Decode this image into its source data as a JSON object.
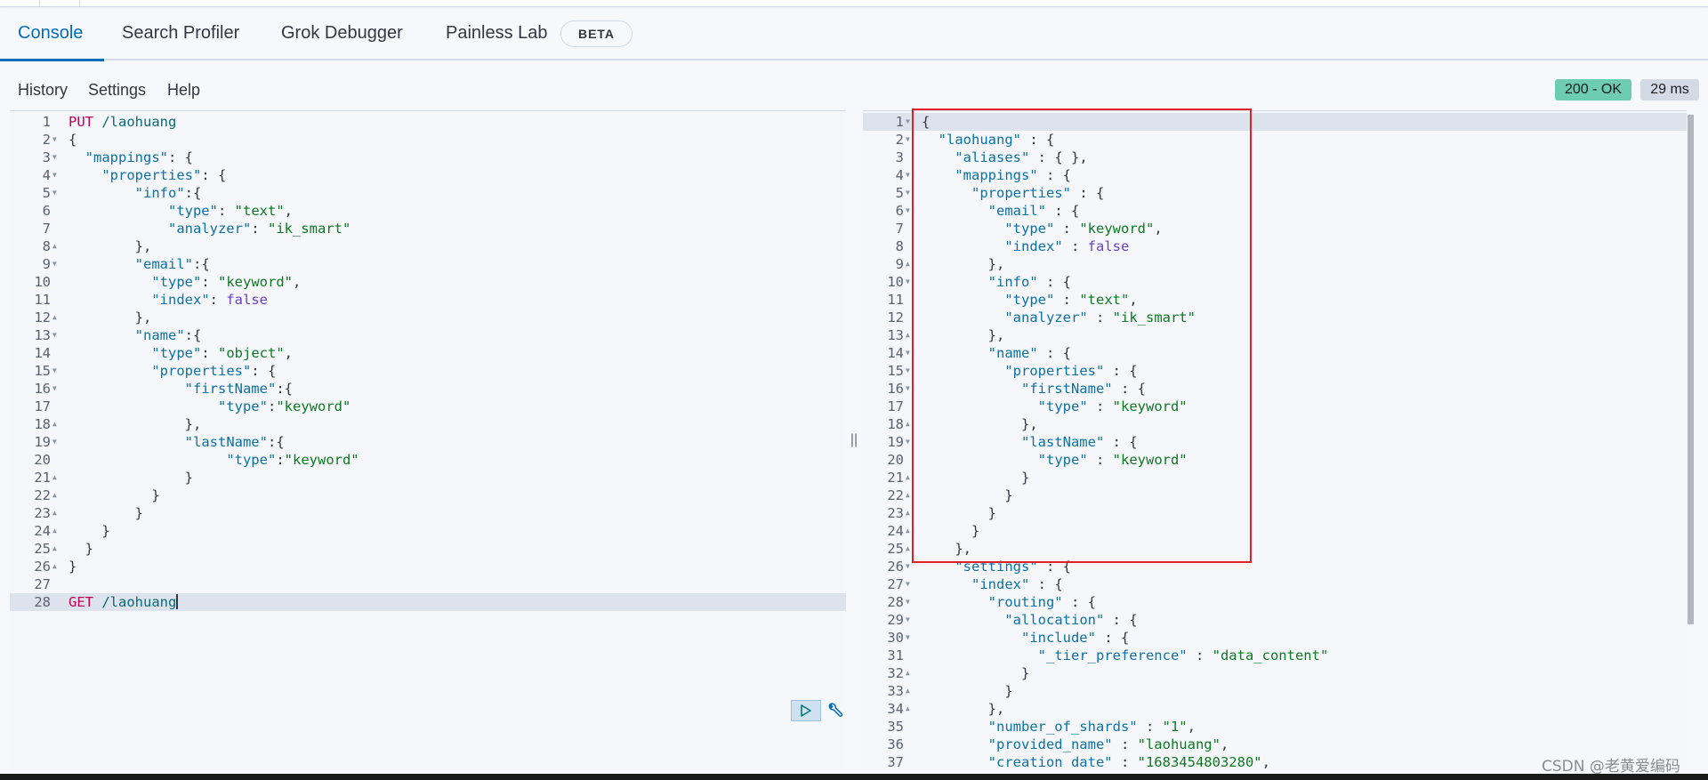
{
  "tabs": [
    {
      "label": "Console",
      "active": true
    },
    {
      "label": "Search Profiler",
      "active": false
    },
    {
      "label": "Grok Debugger",
      "active": false
    },
    {
      "label": "Painless Lab",
      "active": false
    }
  ],
  "beta_badge": "BETA",
  "menu": {
    "history": "History",
    "settings": "Settings",
    "help": "Help"
  },
  "status": {
    "code": "200 - OK",
    "time": "29 ms",
    "ok_color": "#6dccb1"
  },
  "request_editor": {
    "active_line": 28,
    "actions": {
      "run": "play-icon",
      "wrench": "wrench-icon"
    },
    "lines": [
      {
        "n": "1",
        "fold": "",
        "html": "<span class=\"m\">PUT</span> <span class=\"u\">/laohuang</span>"
      },
      {
        "n": "2",
        "fold": "▼",
        "html": "{"
      },
      {
        "n": "3",
        "fold": "▼",
        "html": "  <span class=\"k\">\"mappings\"</span>: {"
      },
      {
        "n": "4",
        "fold": "▼",
        "html": "    <span class=\"k\">\"properties\"</span>: {"
      },
      {
        "n": "5",
        "fold": "▼",
        "html": "        <span class=\"k\">\"info\"</span>:{"
      },
      {
        "n": "6",
        "fold": "",
        "html": "            <span class=\"k\">\"type\"</span>: <span class=\"s\">\"text\"</span>,"
      },
      {
        "n": "7",
        "fold": "",
        "html": "            <span class=\"k\">\"analyzer\"</span>: <span class=\"s\">\"ik_smart\"</span>"
      },
      {
        "n": "8",
        "fold": "▲",
        "html": "        },"
      },
      {
        "n": "9",
        "fold": "▼",
        "html": "        <span class=\"k\">\"email\"</span>:{"
      },
      {
        "n": "10",
        "fold": "",
        "html": "          <span class=\"k\">\"type\"</span>: <span class=\"s\">\"keyword\"</span>,"
      },
      {
        "n": "11",
        "fold": "",
        "html": "          <span class=\"k\">\"index\"</span>: <span class=\"b\">false</span>"
      },
      {
        "n": "12",
        "fold": "▲",
        "html": "        },"
      },
      {
        "n": "13",
        "fold": "▼",
        "html": "        <span class=\"k\">\"name\"</span>:{"
      },
      {
        "n": "14",
        "fold": "",
        "html": "          <span class=\"k\">\"type\"</span>: <span class=\"s\">\"object\"</span>,"
      },
      {
        "n": "15",
        "fold": "▼",
        "html": "          <span class=\"k\">\"properties\"</span>: {"
      },
      {
        "n": "16",
        "fold": "▼",
        "html": "              <span class=\"k\">\"firstName\"</span>:{"
      },
      {
        "n": "17",
        "fold": "",
        "html": "                  <span class=\"k\">\"type\"</span>:<span class=\"s\">\"keyword\"</span>"
      },
      {
        "n": "18",
        "fold": "▲",
        "html": "              },"
      },
      {
        "n": "19",
        "fold": "▼",
        "html": "              <span class=\"k\">\"lastName\"</span>:{"
      },
      {
        "n": "20",
        "fold": "",
        "html": "                   <span class=\"k\">\"type\"</span>:<span class=\"s\">\"keyword\"</span>"
      },
      {
        "n": "21",
        "fold": "▲",
        "html": "              }"
      },
      {
        "n": "22",
        "fold": "▲",
        "html": "          }"
      },
      {
        "n": "23",
        "fold": "▲",
        "html": "        }"
      },
      {
        "n": "24",
        "fold": "▲",
        "html": "    }"
      },
      {
        "n": "25",
        "fold": "▲",
        "html": "  }"
      },
      {
        "n": "26",
        "fold": "▲",
        "html": "}"
      },
      {
        "n": "27",
        "fold": "",
        "html": ""
      },
      {
        "n": "28",
        "fold": "",
        "html": "<span class=\"m\">GET</span> <span class=\"u\">/laohuang</span><span class=\"cursor\"></span>"
      }
    ]
  },
  "response_editor": {
    "active_line": 1,
    "lines": [
      {
        "n": "1",
        "fold": "▼",
        "html": "{"
      },
      {
        "n": "2",
        "fold": "▼",
        "html": "  <span class=\"k\">\"laohuang\"</span> : {"
      },
      {
        "n": "3",
        "fold": "",
        "html": "    <span class=\"k\">\"aliases\"</span> : { },"
      },
      {
        "n": "4",
        "fold": "▼",
        "html": "    <span class=\"k\">\"mappings\"</span> : {"
      },
      {
        "n": "5",
        "fold": "▼",
        "html": "      <span class=\"k\">\"properties\"</span> : {"
      },
      {
        "n": "6",
        "fold": "▼",
        "html": "        <span class=\"k\">\"email\"</span> : {"
      },
      {
        "n": "7",
        "fold": "",
        "html": "          <span class=\"k\">\"type\"</span> : <span class=\"s\">\"keyword\"</span>,"
      },
      {
        "n": "8",
        "fold": "",
        "html": "          <span class=\"k\">\"index\"</span> : <span class=\"b\">false</span>"
      },
      {
        "n": "9",
        "fold": "▲",
        "html": "        },"
      },
      {
        "n": "10",
        "fold": "▼",
        "html": "        <span class=\"k\">\"info\"</span> : {"
      },
      {
        "n": "11",
        "fold": "",
        "html": "          <span class=\"k\">\"type\"</span> : <span class=\"s\">\"text\"</span>,"
      },
      {
        "n": "12",
        "fold": "",
        "html": "          <span class=\"k\">\"analyzer\"</span> : <span class=\"s\">\"ik_smart\"</span>"
      },
      {
        "n": "13",
        "fold": "▲",
        "html": "        },"
      },
      {
        "n": "14",
        "fold": "▼",
        "html": "        <span class=\"k\">\"name\"</span> : {"
      },
      {
        "n": "15",
        "fold": "▼",
        "html": "          <span class=\"k\">\"properties\"</span> : {"
      },
      {
        "n": "16",
        "fold": "▼",
        "html": "            <span class=\"k\">\"firstName\"</span> : {"
      },
      {
        "n": "17",
        "fold": "",
        "html": "              <span class=\"k\">\"type\"</span> : <span class=\"s\">\"keyword\"</span>"
      },
      {
        "n": "18",
        "fold": "▲",
        "html": "            },"
      },
      {
        "n": "19",
        "fold": "▼",
        "html": "            <span class=\"k\">\"lastName\"</span> : {"
      },
      {
        "n": "20",
        "fold": "",
        "html": "              <span class=\"k\">\"type\"</span> : <span class=\"s\">\"keyword\"</span>"
      },
      {
        "n": "21",
        "fold": "▲",
        "html": "            }"
      },
      {
        "n": "22",
        "fold": "▲",
        "html": "          }"
      },
      {
        "n": "23",
        "fold": "▲",
        "html": "        }"
      },
      {
        "n": "24",
        "fold": "▲",
        "html": "      }"
      },
      {
        "n": "25",
        "fold": "▲",
        "html": "    },"
      },
      {
        "n": "26",
        "fold": "▼",
        "html": "    <span class=\"k\">\"settings\"</span> : {"
      },
      {
        "n": "27",
        "fold": "▼",
        "html": "      <span class=\"k\">\"index\"</span> : {"
      },
      {
        "n": "28",
        "fold": "▼",
        "html": "        <span class=\"k\">\"routing\"</span> : {"
      },
      {
        "n": "29",
        "fold": "▼",
        "html": "          <span class=\"k\">\"allocation\"</span> : {"
      },
      {
        "n": "30",
        "fold": "▼",
        "html": "            <span class=\"k\">\"include\"</span> : {"
      },
      {
        "n": "31",
        "fold": "",
        "html": "              <span class=\"k\">\"_tier_preference\"</span> : <span class=\"s\">\"data_content\"</span>"
      },
      {
        "n": "32",
        "fold": "▲",
        "html": "            }"
      },
      {
        "n": "33",
        "fold": "▲",
        "html": "          }"
      },
      {
        "n": "34",
        "fold": "▲",
        "html": "        },"
      },
      {
        "n": "35",
        "fold": "",
        "html": "        <span class=\"k\">\"number_of_shards\"</span> : <span class=\"s\">\"1\"</span>,"
      },
      {
        "n": "36",
        "fold": "",
        "html": "        <span class=\"k\">\"provided_name\"</span> : <span class=\"s\">\"laohuang\"</span>,"
      },
      {
        "n": "37",
        "fold": "",
        "html": "        <span class=\"k\">\"creation_date\"</span> : <span class=\"s\">\"1683454803280\"</span>,"
      }
    ]
  },
  "watermark": "CSDN @老黄爱编码"
}
